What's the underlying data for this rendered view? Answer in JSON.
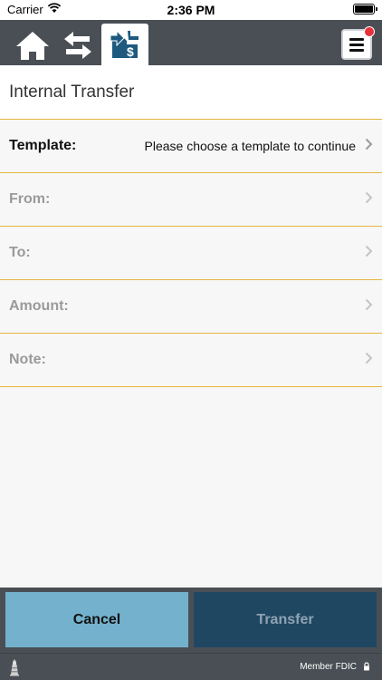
{
  "status_bar": {
    "carrier": "Carrier",
    "time": "2:36 PM"
  },
  "toolbar": {
    "icons": [
      "home-icon",
      "transfer-arrows-icon",
      "internal-transfer-icon",
      "hamburger-menu-icon"
    ],
    "active_tab": "internal-transfer"
  },
  "page": {
    "title": "Internal Transfer"
  },
  "form": {
    "template_label": "Template:",
    "template_value": "Please choose a template to continue",
    "from_label": "From:",
    "to_label": "To:",
    "amount_label": "Amount:",
    "note_label": "Note:"
  },
  "actions": {
    "cancel_label": "Cancel",
    "transfer_label": "Transfer"
  },
  "footer": {
    "member_text": "Member FDIC"
  },
  "colors": {
    "toolbar": "#4a4f55",
    "divider": "#e6b63e",
    "cancel": "#73b1cc",
    "transfer": "#1f4762",
    "badge": "#e8303a"
  }
}
